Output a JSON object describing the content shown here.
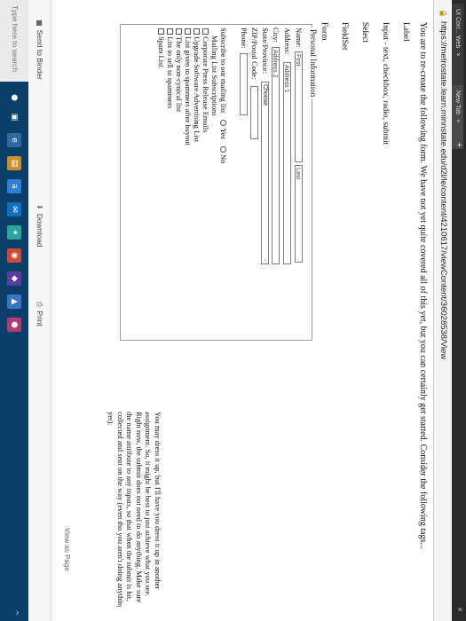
{
  "browser": {
    "tabs": [
      {
        "label": "UI Corr... Web",
        "close": "×"
      },
      {
        "label": "New Tab",
        "close": "×"
      }
    ],
    "new_tab": "+",
    "window_close": "×",
    "url": "https://metrostate.learn.minnstate.edu/d2l/le/content/4210617/viewContent/36028538/View"
  },
  "content": {
    "intro": "You are to re-create the following form. We have not yet quite covered all of this yet, but you can certainly get started. Consider the following tags...",
    "tag_list": [
      "Label",
      "Input - text, checkbox, radio, submit",
      "Select",
      "FieldSet",
      "Form"
    ],
    "form": {
      "legend": "Personal Information",
      "name_label": "Name:",
      "first_placeholder": "First",
      "last_placeholder": "Last",
      "address_label": "Address:",
      "address1_placeholder": "Address 1",
      "city_label": "City:",
      "address2_placeholder": "Address 2",
      "state_label": "State/Province:",
      "select_value": "Choose",
      "zip_label": "ZIP/Postal Code:",
      "phone_label": "Phone:",
      "subscribe_label": "Subscribe to our mailing list",
      "yes_label": "Yes",
      "no_label": "No",
      "subscriptions_label": "Mailing List Subscriptions",
      "checkboxes": [
        "Corporate Press Release Emails",
        "Upgrade Software Advertising List",
        "List given to spammers after buyout",
        "The only non-cynical list",
        "List to sell to spammers",
        "Spam List"
      ]
    },
    "side_note": [
      "You may dress it up, but I'll have you dress it up in another",
      "assignment. So, it might be best to just achieve what you see.",
      "Right now, the submit does not need to do anything. Make sure",
      "the name attribute to any inputs, so that when the submit is hit,",
      "collected and sent on the way (even tho you aren't doing anything",
      "yet)."
    ],
    "view_as_page": "View as Page"
  },
  "toolbar": {
    "send_to_binder": "Send to Binder",
    "download": "Download",
    "print": "Print"
  },
  "taskbar": {
    "search_placeholder": "Type here to search",
    "tray_arrow": "^"
  },
  "icons": {
    "lock": "lock-icon",
    "binder": "binder-icon",
    "download": "download-icon",
    "print": "printer-icon"
  }
}
